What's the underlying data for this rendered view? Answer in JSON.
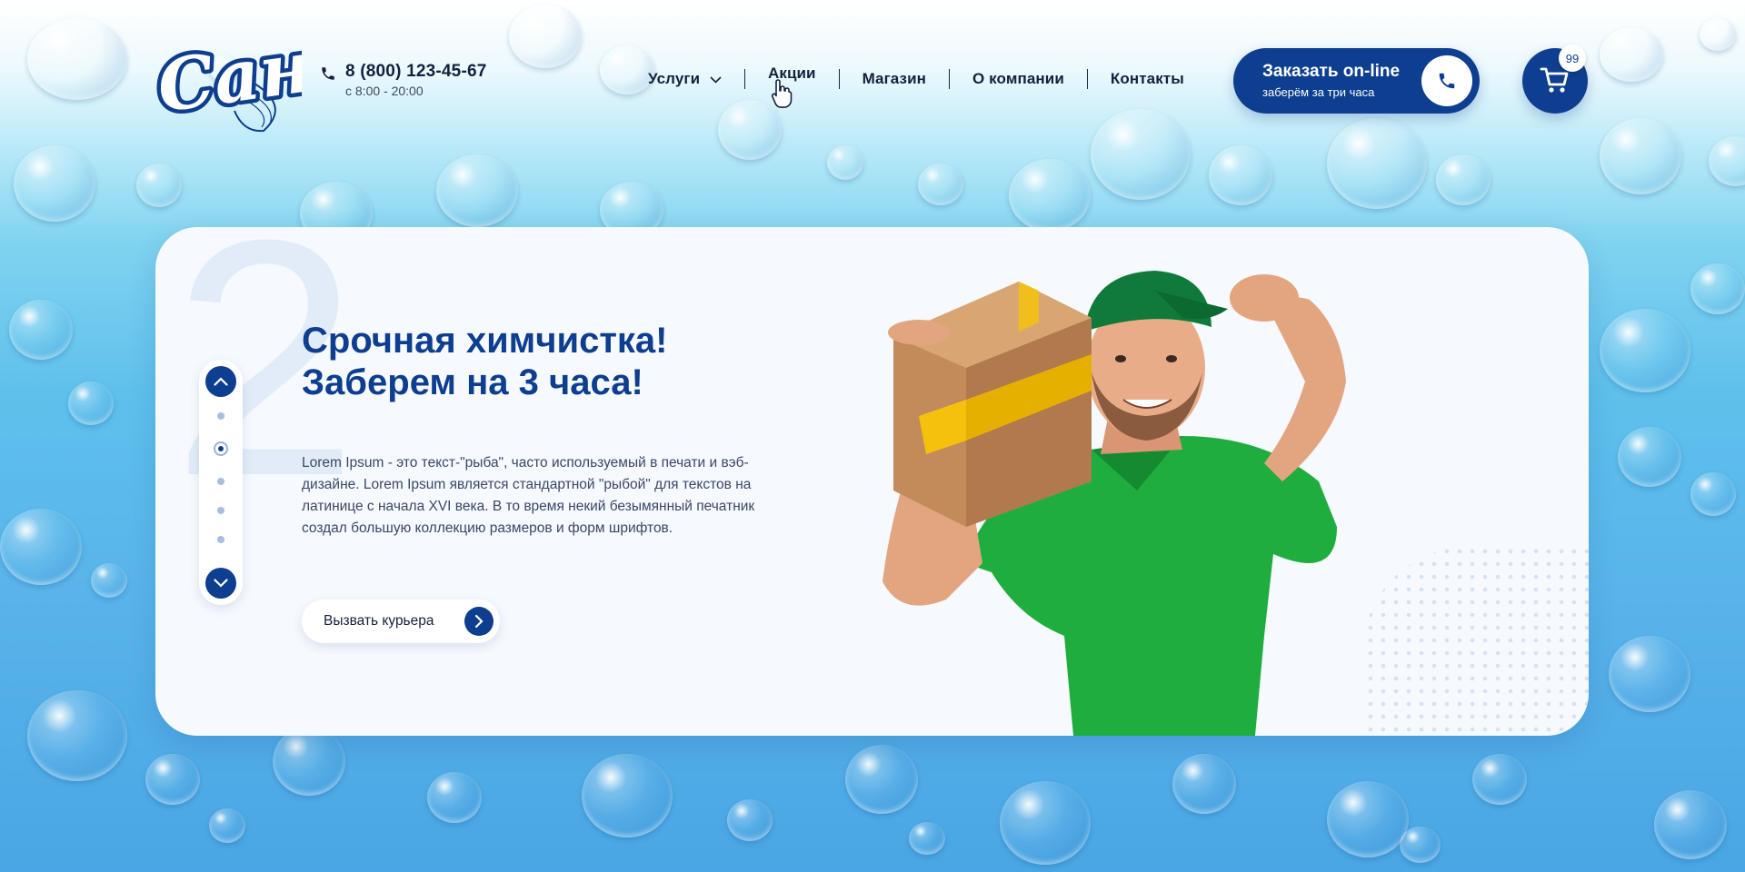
{
  "brand": {
    "logo_text": "Сана"
  },
  "contact": {
    "phone": "8 (800) 123-45-67",
    "hours": "с 8:00 - 20:00"
  },
  "nav": {
    "items": [
      {
        "label": "Услуги",
        "has_dropdown": true
      },
      {
        "label": "Акции"
      },
      {
        "label": "Магазин"
      },
      {
        "label": "О компании"
      },
      {
        "label": "Контакты"
      }
    ]
  },
  "order": {
    "title": "Заказать on-line",
    "subtitle": "заберём за три часа"
  },
  "cart": {
    "count": "99"
  },
  "hero": {
    "slide_number": "2",
    "title": "Срочная химчистка!\nЗаберем на 3 часа!",
    "text": "Lorem Ipsum - это текст-\"рыба\", часто используемый в печати и вэб-дизайне. Lorem Ipsum является стандартной \"рыбой\" для текстов на латинице с начала XVI века. В то время некий безымянный печатник создал большую коллекцию размеров и форм шрифтов.",
    "cta_label": "Вызвать курьера",
    "slider": {
      "total_dots": 5,
      "active_index": 1
    }
  },
  "colors": {
    "brand_blue": "#0d3e8f",
    "text_dark": "#14213d",
    "card_bg": "#f6f9fe",
    "shirt_green": "#1fae3e"
  },
  "icons": {
    "phone": "phone-icon",
    "chevron": "chevron-down-icon",
    "cart": "cart-icon",
    "arrow_up": "arrow-up-icon",
    "arrow_down": "arrow-down-icon",
    "arrow_right": "arrow-right-icon"
  }
}
